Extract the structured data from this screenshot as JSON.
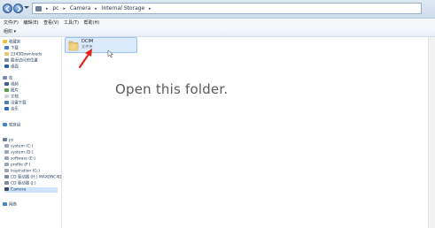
{
  "address_bar": {
    "crumbs": [
      "pc",
      "Camera",
      "Internal Storage"
    ]
  },
  "menu": {
    "items": [
      "文件(F)",
      "编辑(E)",
      "查看(V)",
      "工具(T)",
      "帮助(H)"
    ]
  },
  "toolbar": {
    "organize_label": "组织 ▾"
  },
  "nav": {
    "favorites_header": "收藏夹",
    "favorites": [
      "下载",
      "2345Downloads",
      "最近访问的位置",
      "桌面"
    ],
    "libraries_header": "库",
    "libraries": [
      "视频",
      "图片",
      "文档",
      "迅雷下载",
      "音乐"
    ],
    "homegroup": "家庭组",
    "computer_header": "pc",
    "drives": [
      "system (C:)",
      "system (D:)",
      "software (E:)",
      "profile (F:)",
      "inspiration (G:)",
      "CD 驱动器 (H:) MAXONC4D",
      "CD 驱动器 (J:)",
      "Camera"
    ],
    "network": "网络"
  },
  "main": {
    "folder_name": "DCIM",
    "folder_sub": "文件夹",
    "instruction": "Open this folder."
  }
}
